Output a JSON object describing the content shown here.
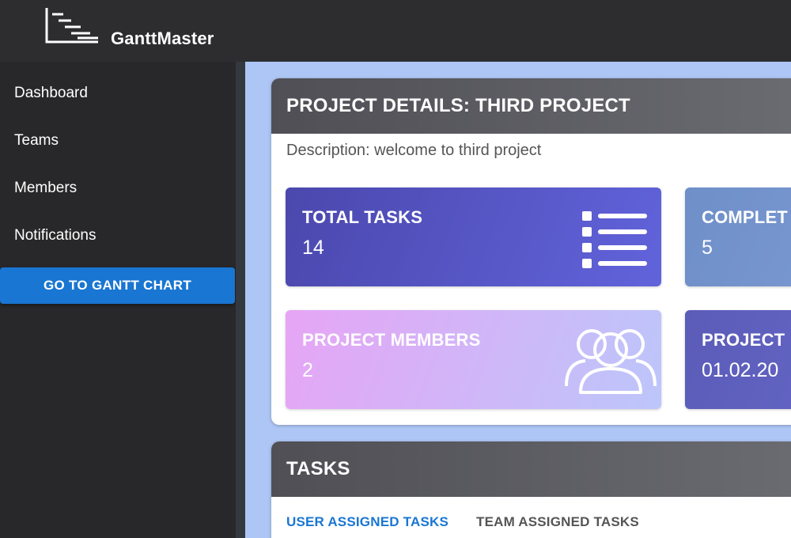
{
  "app": {
    "title": "GanttMaster"
  },
  "sidebar": {
    "items": [
      {
        "label": "Dashboard"
      },
      {
        "label": "Teams"
      },
      {
        "label": "Members"
      },
      {
        "label": "Notifications"
      }
    ],
    "cta_label": "GO TO GANTT CHART"
  },
  "project": {
    "header": "PROJECT DETAILS: THIRD PROJECT",
    "description": "Description: welcome to third project",
    "stats": {
      "total_tasks": {
        "label": "TOTAL TASKS",
        "value": "14",
        "icon": "list-icon"
      },
      "completed": {
        "label": "COMPLET",
        "value": "5"
      },
      "members": {
        "label": "PROJECT MEMBERS",
        "value": "2",
        "icon": "group-icon"
      },
      "project_date": {
        "label": "PROJECT",
        "value": "01.02.20"
      }
    }
  },
  "tasks": {
    "header": "TASKS",
    "tabs": [
      {
        "label": "USER ASSIGNED TASKS",
        "active": true
      },
      {
        "label": "TEAM ASSIGNED TASKS",
        "active": false
      }
    ]
  },
  "colors": {
    "accent": "#1976d2",
    "topbar": "#2d2d30",
    "sidebar": "#28282a",
    "background": "#aec6f5"
  }
}
